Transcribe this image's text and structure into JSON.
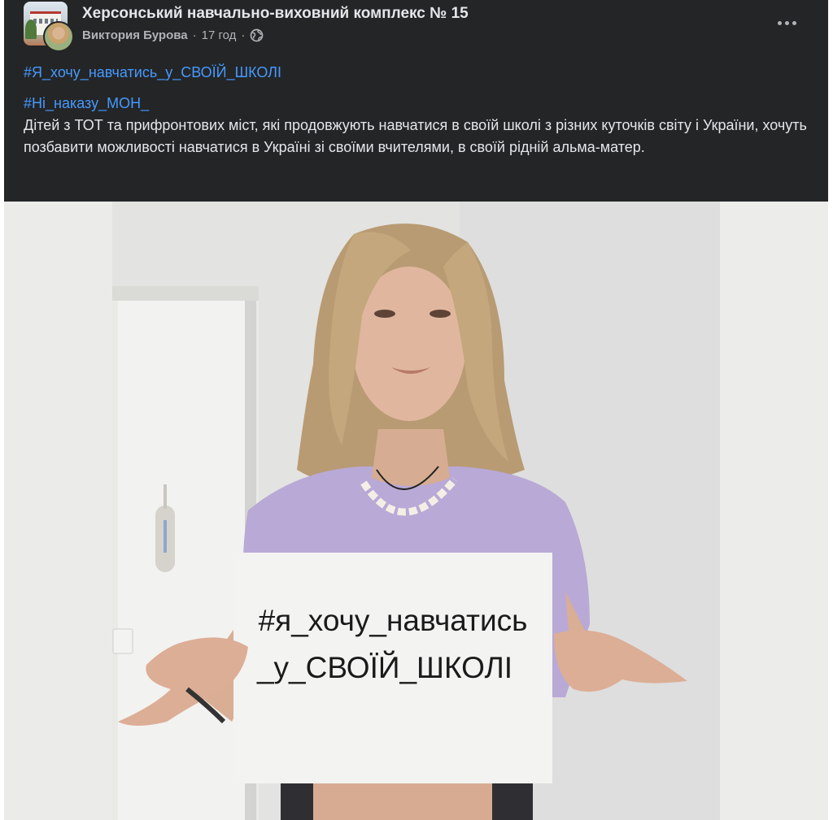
{
  "post": {
    "page_name": "Херсонський навчально-виховний комплекс № 15",
    "author": "Виктория Бурова",
    "separator": "·",
    "time": "17 год",
    "privacy_icon": "globe-icon",
    "more_icon": "more-options-icon",
    "hashtag_1": "#Я_хочу_навчатись_у_СВОЇЙ_ШКОЛІ",
    "hashtag_2": "#Ні_наказу_МОН_",
    "text": "Дітей з ТОТ та прифронтових міст, які продовжують навчатися в своїй школі з різних куточків світу і України, хочуть позбавити можливості навчатися в Україні зі своїми вчителями, в своїй рідній альма-матер.",
    "photo": {
      "sign_line_1": "#я_хочу_навчатись",
      "sign_line_2": "_у_СВОЇЙ_ШКОЛІ"
    }
  },
  "colors": {
    "post_background": "#242526",
    "primary_text": "#e4e6eb",
    "secondary_text": "#b0b3b8",
    "hashtag_link": "#4599ff"
  }
}
